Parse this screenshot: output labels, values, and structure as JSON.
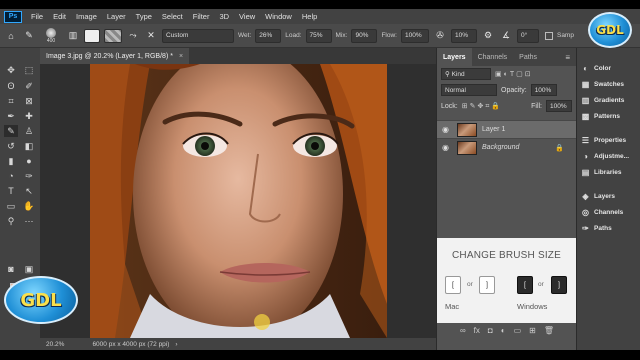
{
  "menubar": {
    "logo": "Ps",
    "items": [
      "File",
      "Edit",
      "Image",
      "Layer",
      "Type",
      "Select",
      "Filter",
      "3D",
      "View",
      "Window",
      "Help"
    ]
  },
  "options": {
    "brush_size": "400",
    "preset": "Custom",
    "wet_label": "Wet:",
    "wet": "26%",
    "load_label": "Load:",
    "load": "75%",
    "mix_label": "Mix:",
    "mix": "90%",
    "flow_label": "Flow:",
    "flow": "100%",
    "angle": "10%",
    "angle2": "0°",
    "sample_label": "Samp"
  },
  "document": {
    "tab_title": "Image 3.jpg @ 20.2% (Layer 1, RGB/8) *",
    "zoom": "20.2%",
    "dims": "6000 px x 4000 px (72 ppi)"
  },
  "layers_panel": {
    "tabs": [
      "Layers",
      "Channels",
      "Paths"
    ],
    "kind_label": "Kind",
    "blend_mode": "Normal",
    "opacity_label": "Opacity:",
    "opacity": "100%",
    "lock_label": "Lock:",
    "fill_label": "Fill:",
    "fill": "100%",
    "layers": [
      {
        "name": "Layer 1",
        "selected": true
      },
      {
        "name": "Background",
        "selected": false
      }
    ]
  },
  "brush_card": {
    "title": "CHANGE BRUSH SIZE",
    "mac_label": "Mac",
    "windows_label": "Windows",
    "or": "or",
    "key_left": "[",
    "key_right": "]"
  },
  "dock": {
    "items": [
      "Color",
      "Swatches",
      "Gradients",
      "Patterns",
      "Properties",
      "Adjustme...",
      "Libraries",
      "Layers",
      "Channels",
      "Paths"
    ]
  },
  "watermark": {
    "text": "GDL"
  },
  "colors": {
    "foreground": "#e8b89a",
    "background": "#ffffff",
    "accent": "#31a8ff"
  }
}
